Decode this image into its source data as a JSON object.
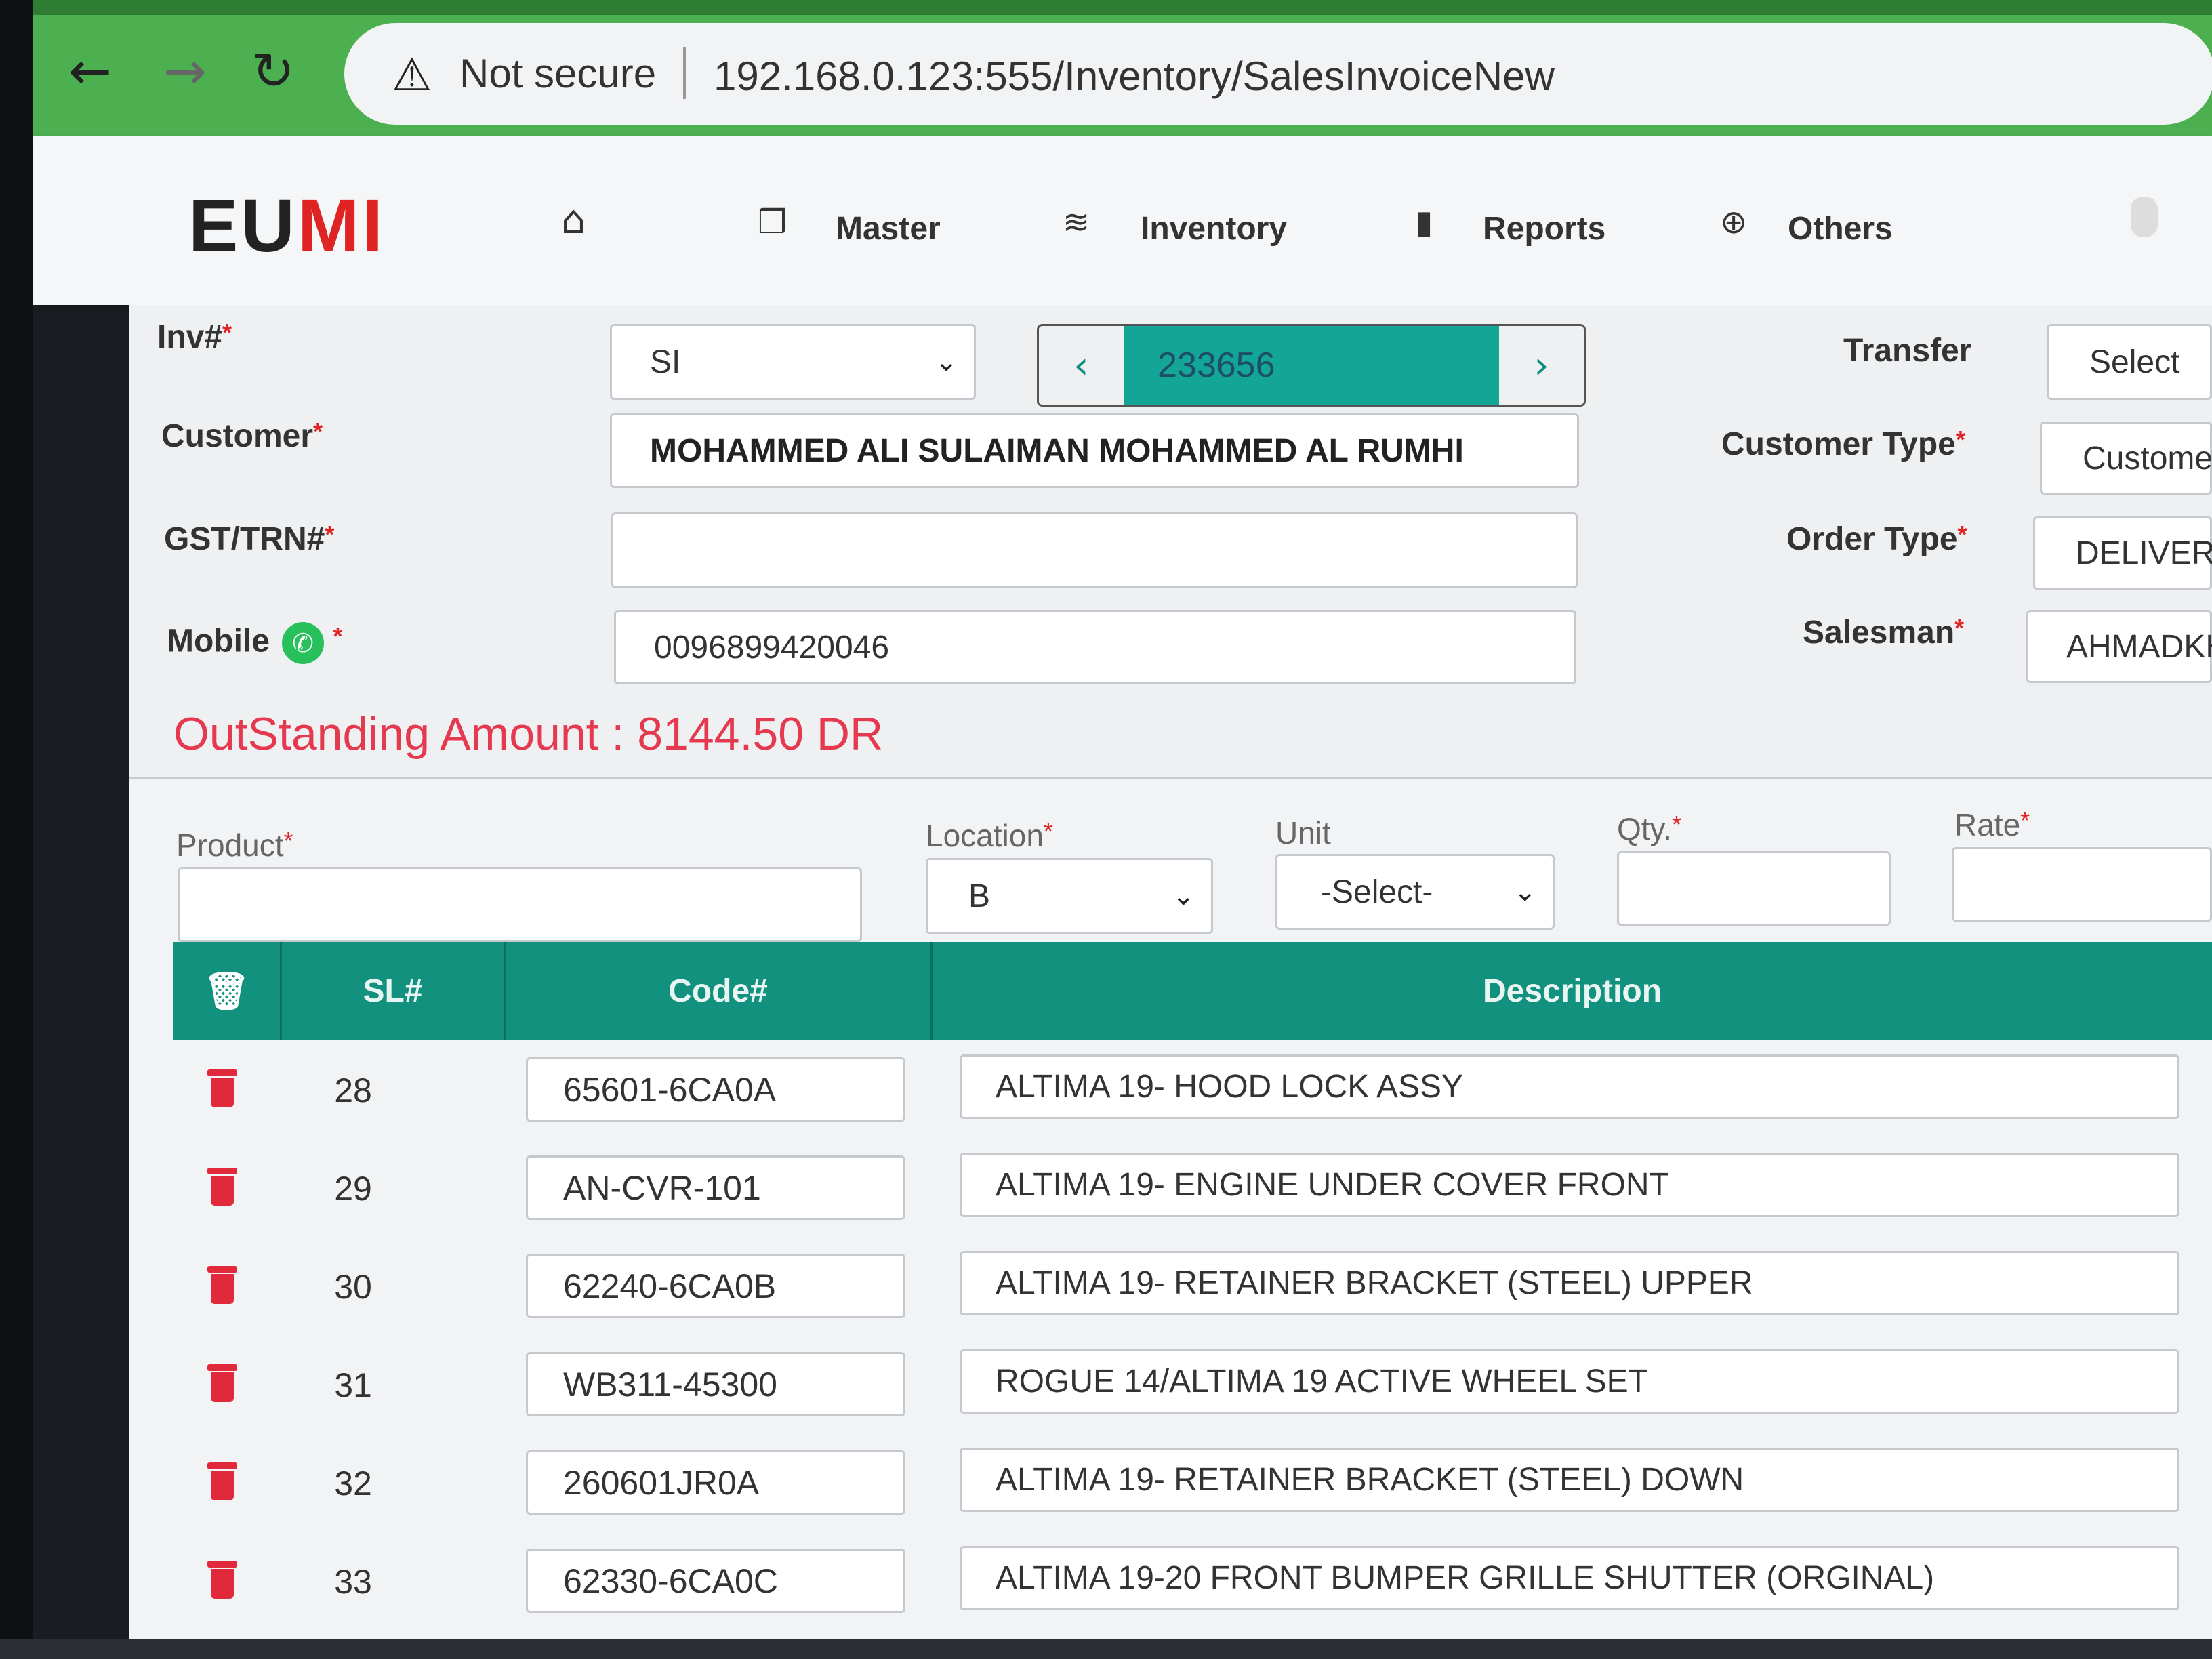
{
  "browser": {
    "security_label": "Not secure",
    "url": "192.168.0.123:555/Inventory/SalesInvoiceNew"
  },
  "app": {
    "logo_text": "EUMI",
    "menu": {
      "master": "Master",
      "inventory": "Inventory",
      "reports": "Reports",
      "others": "Others"
    }
  },
  "form": {
    "inv_label": "Inv#",
    "inv_type": "SI",
    "inv_number": "233656",
    "customer_label": "Customer",
    "customer_value": "MOHAMMED ALI SULAIMAN MOHAMMED AL RUMHI",
    "gst_label": "GST/TRN#",
    "gst_value": "",
    "mobile_label": "Mobile",
    "mobile_value": "0096899420046",
    "outstanding": "OutStanding Amount : 8144.50 DR",
    "transfer_label": "Transfer",
    "transfer_value": "Select",
    "customer_type_label": "Customer Type",
    "customer_type_value": "Customer",
    "order_type_label": "Order Type",
    "order_type_value": "DELIVERY",
    "salesman_label": "Salesman",
    "salesman_value": "AHMADKH"
  },
  "entry": {
    "product_label": "Product",
    "location_label": "Location",
    "location_value": "B",
    "unit_label": "Unit",
    "unit_value": "-Select-",
    "qty_label": "Qty.",
    "rate_label": "Rate"
  },
  "table": {
    "headers": {
      "sl": "SL#",
      "code": "Code#",
      "description": "Description"
    },
    "rows": [
      {
        "sl": "28",
        "code": "65601-6CA0A",
        "description": "ALTIMA 19- HOOD LOCK ASSY"
      },
      {
        "sl": "29",
        "code": "AN-CVR-101",
        "description": "ALTIMA 19- ENGINE UNDER COVER FRONT"
      },
      {
        "sl": "30",
        "code": "62240-6CA0B",
        "description": "ALTIMA 19- RETAINER BRACKET (STEEL) UPPER"
      },
      {
        "sl": "31",
        "code": "WB311-45300",
        "description": "ROGUE 14/ALTIMA 19 ACTIVE WHEEL SET"
      },
      {
        "sl": "32",
        "code": "260601JR0A",
        "description": "ALTIMA 19- RETAINER BRACKET (STEEL) DOWN"
      },
      {
        "sl": "33",
        "code": "62330-6CA0C",
        "description": "ALTIMA 19-20 FRONT BUMPER GRILLE SHUTTER (ORGINAL)"
      }
    ]
  }
}
